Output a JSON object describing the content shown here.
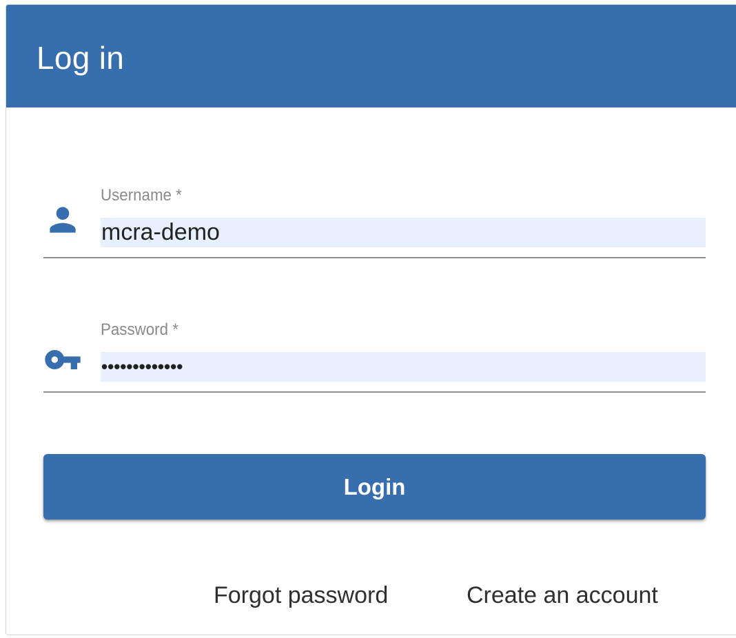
{
  "header": {
    "title": "Log in",
    "background_color": "#376eae"
  },
  "form": {
    "username": {
      "label": "Username *",
      "value": "mcra-demo",
      "icon": "person-icon"
    },
    "password": {
      "label": "Password *",
      "value": "•••••••••••••",
      "icon": "key-icon"
    },
    "autofill_color": "#e8f0fe"
  },
  "actions": {
    "login_label": "Login",
    "forgot_password_label": "Forgot password",
    "create_account_label": "Create an account"
  },
  "colors": {
    "accent": "#376eae",
    "icon": "#376eae",
    "label": "#8a8a8a",
    "link_text": "#2f2f2f"
  }
}
